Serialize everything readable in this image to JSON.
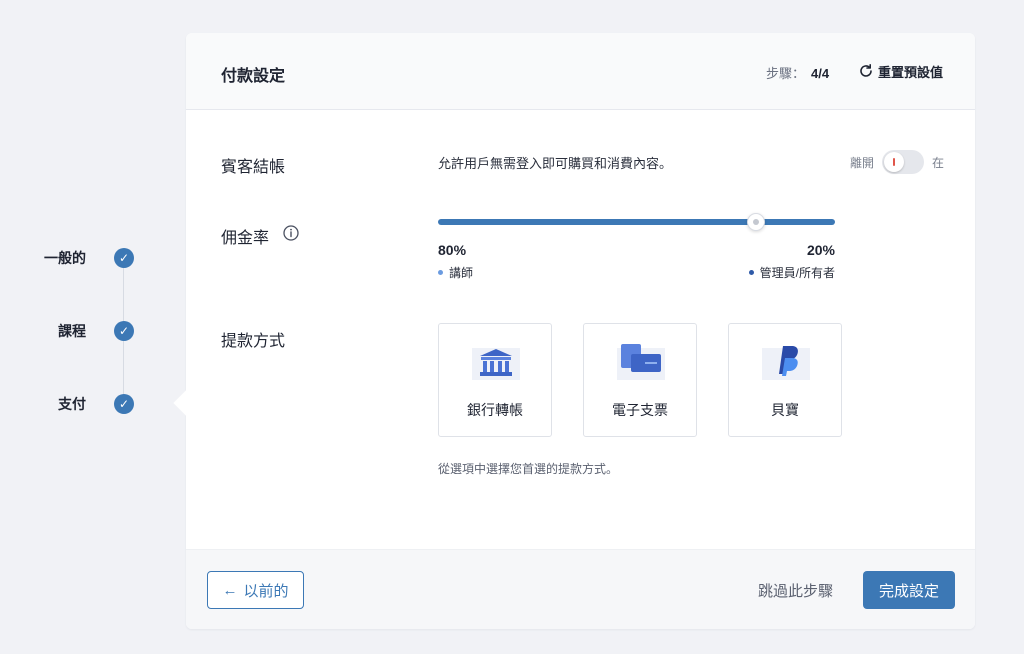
{
  "stepper": {
    "steps": [
      {
        "label": "一般的",
        "completed": true
      },
      {
        "label": "課程",
        "completed": true
      },
      {
        "label": "支付",
        "completed": true
      }
    ]
  },
  "header": {
    "title": "付款設定",
    "step_label": "步驟：",
    "step_value": "4/4",
    "reset_label": "重置預設值"
  },
  "guest_checkout": {
    "label": "賓客結帳",
    "description": "允許用戶無需登入即可購買和消費內容。",
    "toggle_off_label": "離開",
    "toggle_on_label": "在",
    "enabled": false
  },
  "commission": {
    "label": "佣金率",
    "instructor_percent": "80%",
    "instructor_label": "講師",
    "admin_percent": "20%",
    "admin_label": "管理員/所有者",
    "instructor_share": 0.8
  },
  "payout": {
    "label": "提款方式",
    "methods": [
      {
        "label": "銀行轉帳",
        "icon": "bank-icon"
      },
      {
        "label": "電子支票",
        "icon": "echeck-icon"
      },
      {
        "label": "貝寶",
        "icon": "paypal-icon"
      }
    ],
    "hint": "從選項中選擇您首選的提款方式。"
  },
  "footer": {
    "prev_label": "以前的",
    "prev_arrow": "←",
    "skip_label": "跳過此步驟",
    "finish_label": "完成設定"
  },
  "colors": {
    "accent": "#3c78b5",
    "background": "#f1f2f6",
    "instructor_dot": "#6b9be0",
    "admin_dot": "#2f5aa8"
  }
}
